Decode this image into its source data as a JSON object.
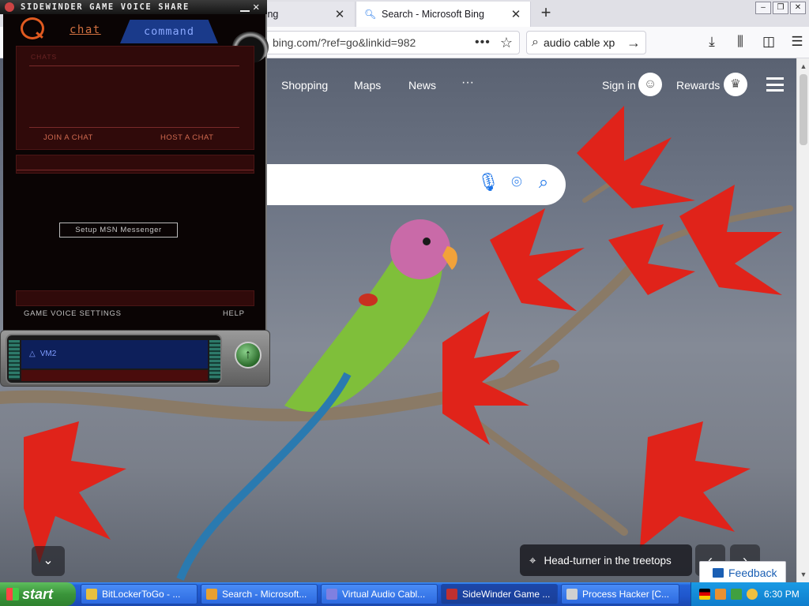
{
  "browser": {
    "tabs": [
      {
        "title": "oft Bing",
        "close": "✕"
      },
      {
        "title": "Search - Microsoft Bing",
        "close": "✕"
      }
    ],
    "new_tab": "+",
    "window_buttons": [
      "–",
      "❐",
      "✕"
    ],
    "url": "bing.com/?ref=go&linkid=982",
    "url_menu": "•••",
    "bookmark_star": "☆",
    "search_query": "audio cable xp",
    "search_go": "→",
    "tool_icons": [
      "download-icon",
      "library-icon",
      "sidebar-icon",
      "menu-icon"
    ]
  },
  "bing": {
    "nav": [
      "Shopping",
      "Maps",
      "News",
      "···"
    ],
    "sign_in": "Sign in",
    "rewards": "Rewards",
    "caption": "Head-turner in the treetops",
    "feedback": "Feedback",
    "chevron_down": "⌄",
    "prev_arrow": "‹",
    "next_arrow": "›"
  },
  "gamevoice": {
    "title": "SIDEWINDER GAME VOICE SHARE",
    "tab_chat": "chat",
    "tab_command": "command",
    "chats_label": "CHATS",
    "join_chat": "JOIN A CHAT",
    "host_chat": "HOST A CHAT",
    "setup_button": "Setup MSN Messenger",
    "settings_link": "GAME VOICE SETTINGS",
    "help_link": "HELP",
    "channel": "VM2"
  },
  "taskbar": {
    "start": "start",
    "buttons": [
      "BitLockerToGo - ...",
      "Search - Microsoft...",
      "Virtual Audio Cabl...",
      "SideWinder Game ...",
      "Process Hacker [C..."
    ],
    "active_index": 3,
    "clock": "6:30 PM"
  },
  "colors": {
    "bing_accent": "#1a73e8",
    "gv_accent": "#e05a20",
    "gv_command_tab": "#1a3a8a",
    "taskbar_blue": "#2462d8",
    "start_green": "#3a943a"
  }
}
